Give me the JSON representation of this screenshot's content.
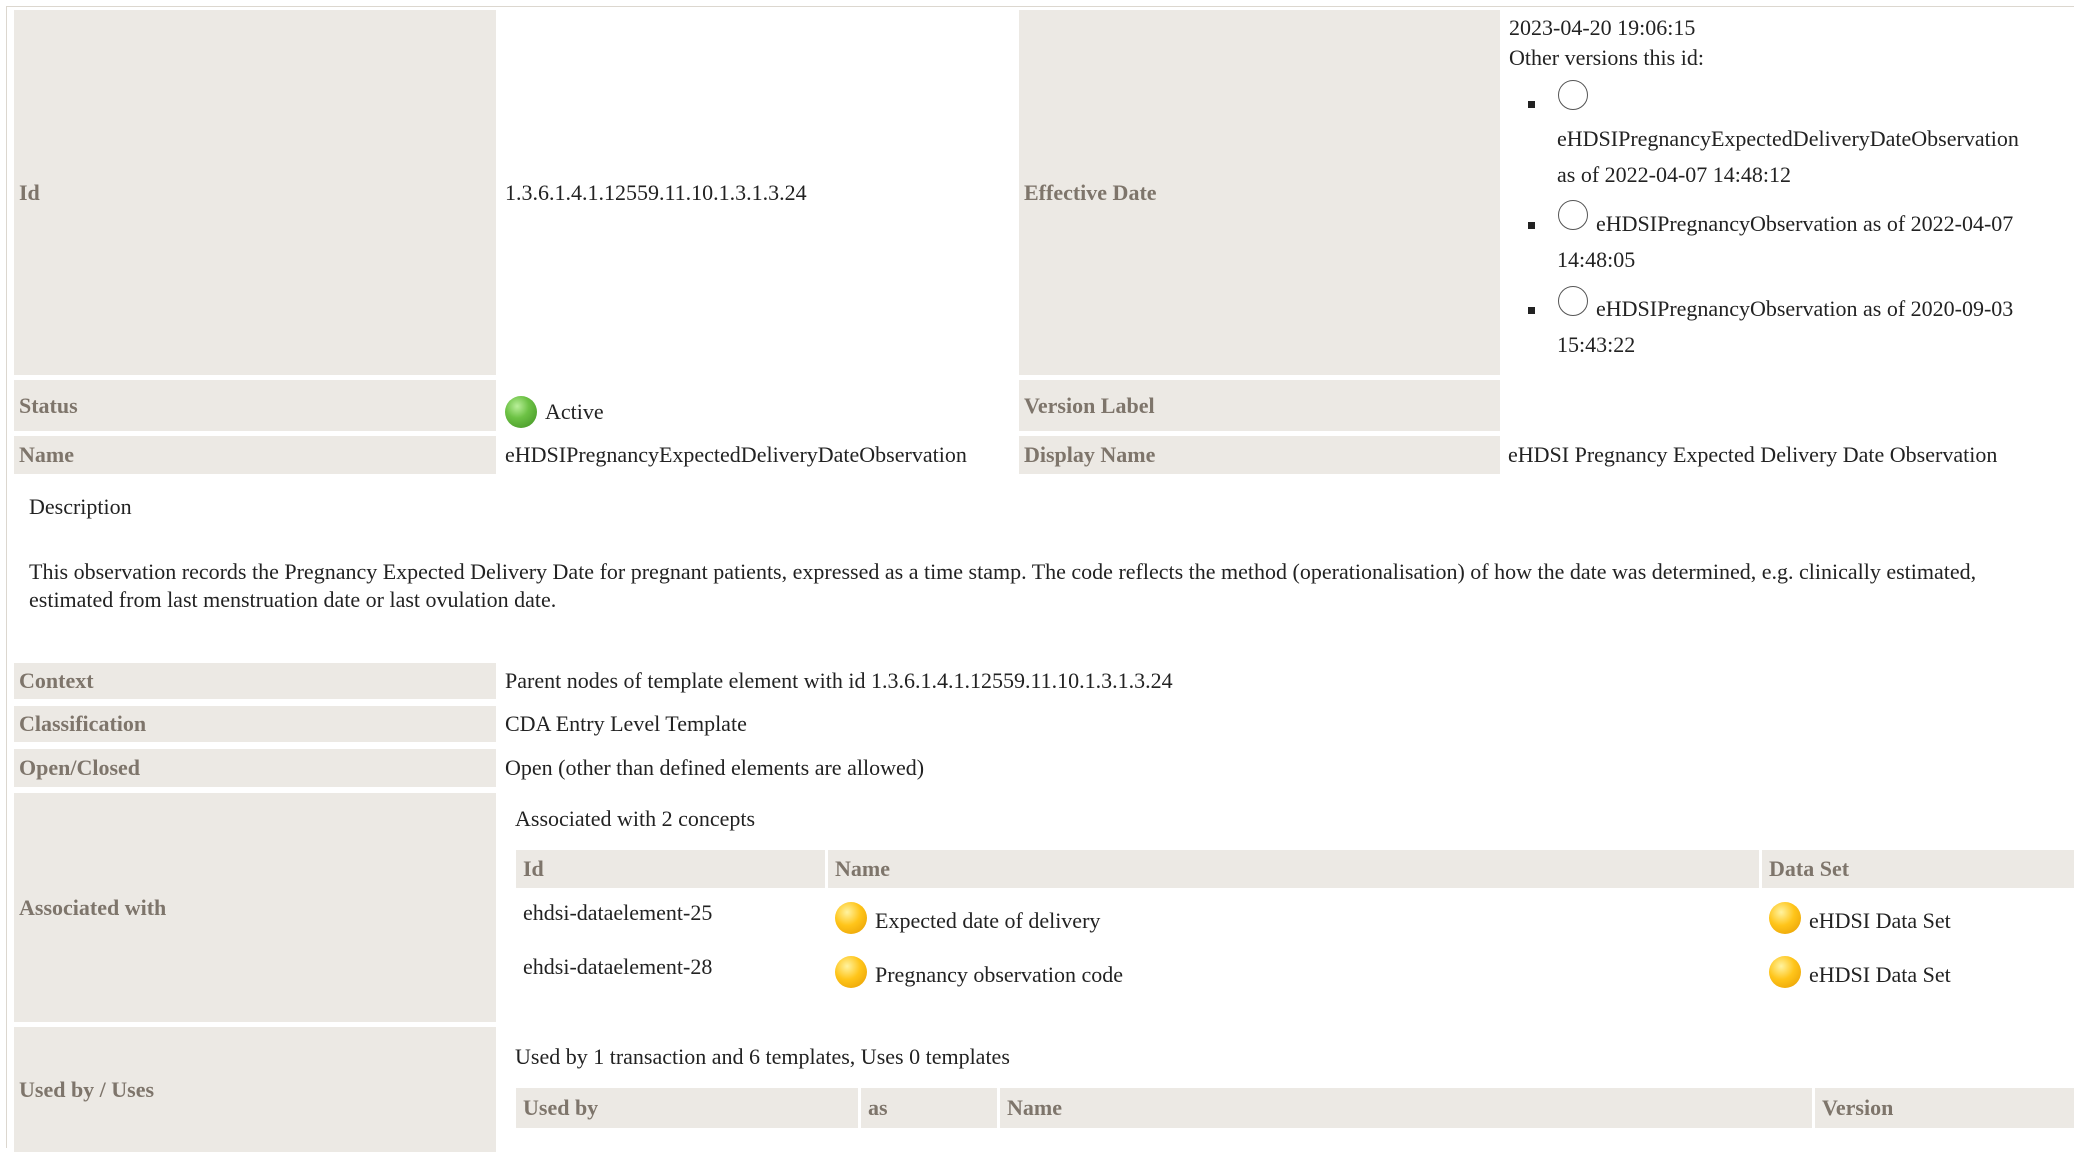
{
  "header": {
    "id_label": "Id",
    "id_value": "1.3.6.1.4.1.12559.11.10.1.3.1.3.24",
    "effective_date_label": "Effective Date",
    "effective_date_value": "2023-04-20 19:06:15",
    "other_versions_label": "Other versions this id:",
    "other_versions": [
      {
        "name": "eHDSIPregnancyExpectedDeliveryDateObservation",
        "as_of": "as of 2022-04-07 14:48:12"
      },
      {
        "name": "eHDSIPregnancyObservation as of 2022-04-07",
        "as_of": "14:48:05"
      },
      {
        "name": "eHDSIPregnancyObservation as of 2020-09-03",
        "as_of": "15:43:22"
      }
    ],
    "status_label": "Status",
    "status_value": "Active",
    "version_label_label": "Version Label",
    "version_label_value": "",
    "name_label": "Name",
    "name_value": "eHDSIPregnancyExpectedDeliveryDateObservation",
    "display_name_label": "Display Name",
    "display_name_value": "eHDSI Pregnancy Expected Delivery Date Observation"
  },
  "description": {
    "heading": "Description",
    "text": "This observation records the Pregnancy Expected Delivery Date for pregnant patients, expressed as a time stamp. The code reflects the method (operationalisation) of how the date was determined, e.g. clinically estimated, estimated from last menstruation date or last ovulation date."
  },
  "details": {
    "context_label": "Context",
    "context_value": "Parent nodes of template element with id 1.3.6.1.4.1.12559.11.10.1.3.1.3.24",
    "classification_label": "Classification",
    "classification_value": "CDA Entry Level Template",
    "open_closed_label": "Open/Closed",
    "open_closed_value": "Open (other than defined elements are allowed)"
  },
  "associated": {
    "label": "Associated with",
    "summary": "Associated with 2 concepts",
    "columns": [
      "Id",
      "Name",
      "Data Set"
    ],
    "rows": [
      {
        "id": "ehdsi-dataelement-25",
        "name": "Expected date of delivery",
        "dataset": "eHDSI Data Set"
      },
      {
        "id": "ehdsi-dataelement-28",
        "name": "Pregnancy observation code",
        "dataset": "eHDSI Data Set"
      }
    ]
  },
  "used_by": {
    "label": "Used by / Uses",
    "summary": "Used by 1 transaction and 6 templates, Uses 0 templates",
    "columns": [
      "Used by",
      "as",
      "Name",
      "Version"
    ]
  },
  "colors": {
    "label_bg": "#ece9e4",
    "label_text": "#7e756b",
    "status_active": "#5cb33a",
    "concept_status": "#ffc51a"
  }
}
